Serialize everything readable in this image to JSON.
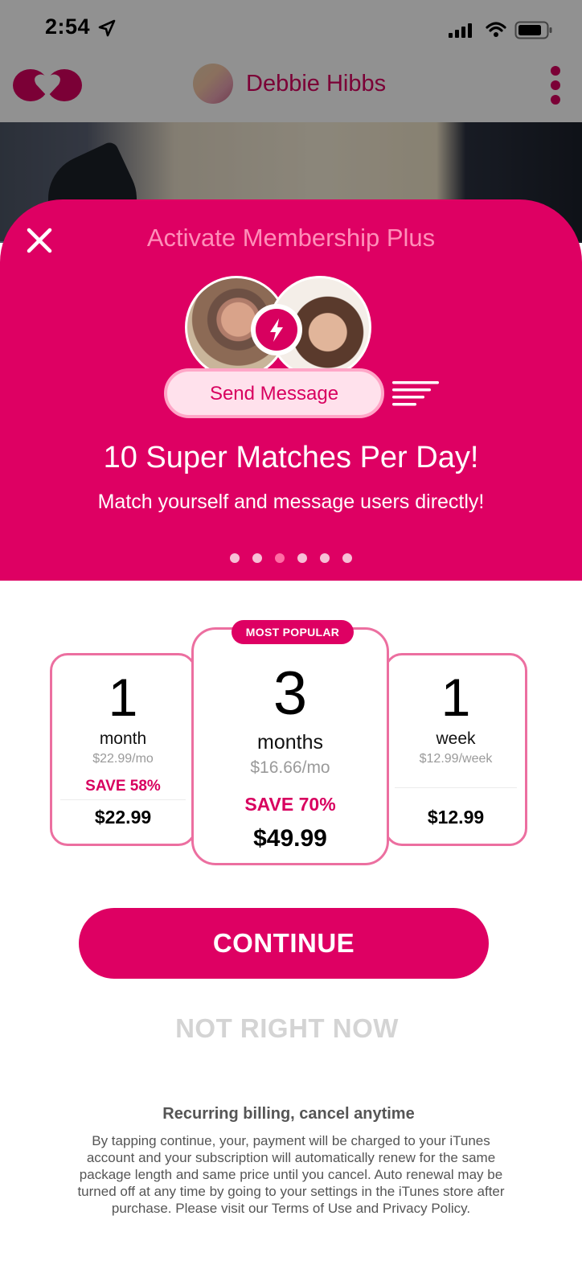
{
  "status_bar": {
    "time": "2:54"
  },
  "header": {
    "profile_name": "Debbie Hibbs"
  },
  "modal": {
    "title": "Activate Membership Plus",
    "send_message_label": "Send Message",
    "feature_headline": "10 Super Matches Per Day!",
    "feature_subtitle": "Match yourself and message users directly!",
    "carousel": {
      "count": 6,
      "active_index": 2
    }
  },
  "plans": {
    "most_popular_label": "MOST POPULAR",
    "items": [
      {
        "count": "1",
        "unit": "month",
        "rate": "$22.99/mo",
        "save": "SAVE 58%",
        "total": "$22.99"
      },
      {
        "count": "3",
        "unit": "months",
        "rate": "$16.66/mo",
        "save": "SAVE 70%",
        "total": "$49.99"
      },
      {
        "count": "1",
        "unit": "week",
        "rate": "$12.99/week",
        "save": "",
        "total": "$12.99"
      }
    ],
    "selected_index": 1
  },
  "actions": {
    "continue_label": "CONTINUE",
    "not_now_label": "NOT RIGHT NOW"
  },
  "billing": {
    "title": "Recurring billing, cancel anytime",
    "text": "By tapping continue, your, payment will be charged to your iTunes account and your subscription will automatically renew for the same package length and same price until you cancel. Auto renewal may be turned off at any time by going to your settings in the iTunes store after purchase. Please visit our Terms of Use and Privacy Policy."
  },
  "colors": {
    "brand": "#de0063",
    "title_pink": "#ff8fb9",
    "border_pink": "#ec6fa0"
  },
  "icons": [
    "location-arrow-icon",
    "signal-icon",
    "wifi-icon",
    "battery-icon",
    "heart-logo-icon",
    "more-vertical-icon",
    "close-icon",
    "lightning-bolt-icon",
    "lines-icon"
  ]
}
